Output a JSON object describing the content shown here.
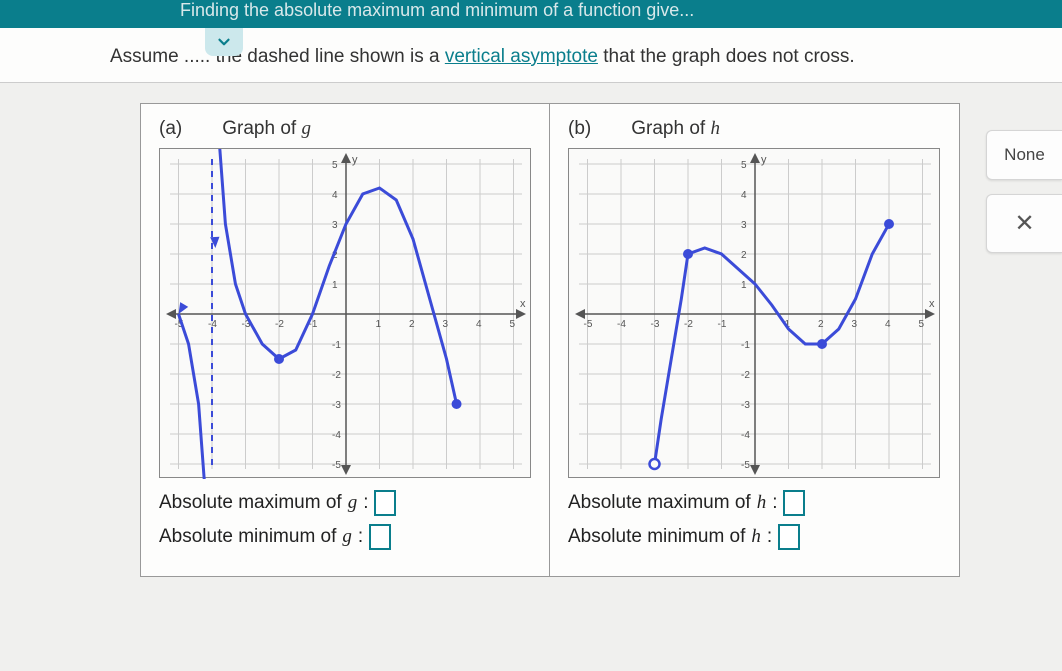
{
  "header": {
    "title": "Finding the absolute maximum and minimum of a function give..."
  },
  "prompt": {
    "prefix": "Assume ",
    "obscured": ".....",
    "mid": " the dashed line shown is a ",
    "link": "vertical asymptote",
    "suffix": " that the graph does not cross."
  },
  "panels": {
    "a": {
      "part": "(a)",
      "title_prefix": "Graph of ",
      "fn": "g",
      "abs_max_label": "Absolute maximum of ",
      "abs_min_label": "Absolute minimum of ",
      "colon": ": "
    },
    "b": {
      "part": "(b)",
      "title_prefix": "Graph of ",
      "fn": "h",
      "abs_max_label": "Absolute maximum of ",
      "abs_min_label": "Absolute minimum of ",
      "colon": ": "
    }
  },
  "side": {
    "none": "None",
    "x": "✕"
  },
  "axes": {
    "x": "x",
    "y": "y"
  },
  "chart_data": [
    {
      "id": "graph-g",
      "type": "line",
      "xlabel": "x",
      "ylabel": "y",
      "xlim": [
        -5,
        5
      ],
      "ylim": [
        -5,
        5
      ],
      "x_ticks": [
        -5,
        -4,
        -3,
        -2,
        -1,
        1,
        2,
        3,
        4,
        5
      ],
      "y_ticks": [
        -5,
        -4,
        -3,
        -2,
        -1,
        1,
        2,
        3,
        4,
        5
      ],
      "vertical_asymptote": -4,
      "series": [
        {
          "name": "g-left",
          "x": [
            -5,
            -4.7,
            -4.4,
            -4.2,
            -4.05
          ],
          "values": [
            0,
            -1,
            -3,
            -6,
            -10
          ],
          "arrow_end": "start"
        },
        {
          "name": "g-right",
          "x": [
            -3.95,
            -3.8,
            -3.6,
            -3.3,
            -3,
            -2.5,
            -2,
            -1.5,
            -1,
            -0.5,
            0,
            0.5,
            1,
            1.5,
            2,
            2.5,
            3,
            3.3
          ],
          "values": [
            10,
            6,
            3,
            1,
            0,
            -1,
            -1.5,
            -1.2,
            0,
            1.6,
            3,
            4,
            4.2,
            3.8,
            2.5,
            0.5,
            -1.5,
            -3
          ],
          "arrow_end": "start",
          "closed_point": {
            "x": 3.3,
            "y": -3
          },
          "min_closed_point": {
            "x": -2,
            "y": -1.5
          }
        }
      ]
    },
    {
      "id": "graph-h",
      "type": "line",
      "xlabel": "x",
      "ylabel": "y",
      "xlim": [
        -5,
        5
      ],
      "ylim": [
        -5,
        5
      ],
      "x_ticks": [
        -5,
        -4,
        -3,
        -2,
        -1,
        1,
        2,
        3,
        4,
        5
      ],
      "y_ticks": [
        -5,
        -4,
        -3,
        -2,
        -1,
        1,
        2,
        3,
        4,
        5
      ],
      "series": [
        {
          "name": "h",
          "x": [
            -3,
            -2.8,
            -2.5,
            -2.2,
            -2,
            -1.5,
            -1,
            -0.5,
            0,
            0.5,
            1,
            1.5,
            2,
            2.5,
            3,
            3.5,
            4
          ],
          "values": [
            -5,
            -3.5,
            -1.5,
            0.5,
            2,
            2.2,
            2,
            1.5,
            1,
            0.3,
            -0.5,
            -1,
            -1,
            -0.5,
            0.5,
            2,
            3
          ],
          "open_point": {
            "x": -3,
            "y": -5
          },
          "closed_points": [
            {
              "x": -2,
              "y": 2
            },
            {
              "x": 2,
              "y": -1
            },
            {
              "x": 4,
              "y": 3
            }
          ]
        }
      ]
    }
  ]
}
